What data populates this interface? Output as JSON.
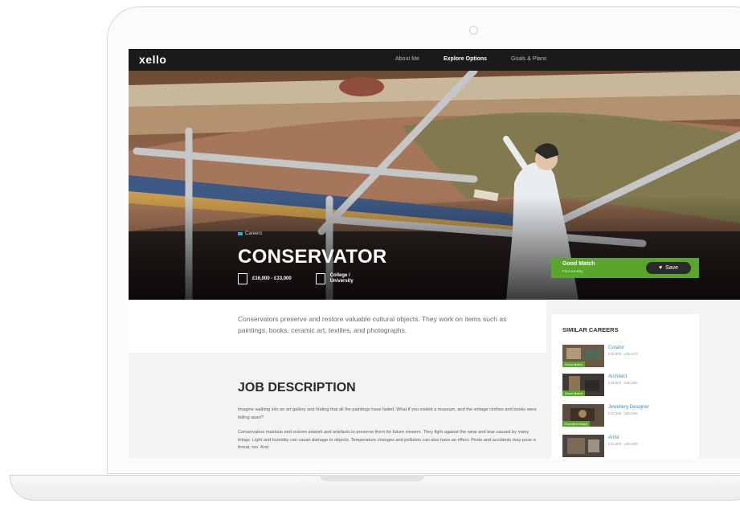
{
  "app": {
    "logo": "xello"
  },
  "nav": {
    "items": [
      "About Me",
      "Explore Options",
      "Goals & Plans"
    ],
    "active": "Explore Options"
  },
  "hero": {
    "breadcrumb": "Careers",
    "title": "CONSERVATOR",
    "salary": "£16,000 - £33,000",
    "education": [
      "College /",
      "University"
    ]
  },
  "match": {
    "label": "Good Match",
    "sub": "Find out why",
    "save_label": "Save"
  },
  "intro": "Conservators preserve and restore valuable cultural objects. They work on items such as paintings, books, ceramic art, textiles, and photographs.",
  "job": {
    "heading": "JOB DESCRIPTION",
    "paragraphs": [
      "Imagine walking into an art gallery and finding that all the paintings have faded. What if you visited a museum, and the vintage clothes and books were falling apart?",
      "Conservators maintain and restore artwork and artefacts to preserve them for future viewers. They fight against the wear and tear caused by many things. Light and humidity can cause damage to objects. Temperature changes and pollution can also have an effect. Pests and accidents may pose a threat, too. And"
    ]
  },
  "similar": {
    "heading": "SIMILAR CAREERS",
    "items": [
      {
        "name": "Curator",
        "salary": "£16,000 - £38,373",
        "badge": "Good Match"
      },
      {
        "name": "Architect",
        "salary": "£16,000 - £35,000",
        "badge": "Good Match"
      },
      {
        "name": "Jewellery Designer",
        "salary": "£21,690 - £50,000",
        "badge": "Excellent Match"
      },
      {
        "name": "Artist",
        "salary": "£21,000 - £50,000",
        "badge": ""
      }
    ]
  },
  "colors": {
    "accent_green": "#5aa62c",
    "link_blue": "#3a8fc9",
    "topbar": "#1a1a1a"
  }
}
